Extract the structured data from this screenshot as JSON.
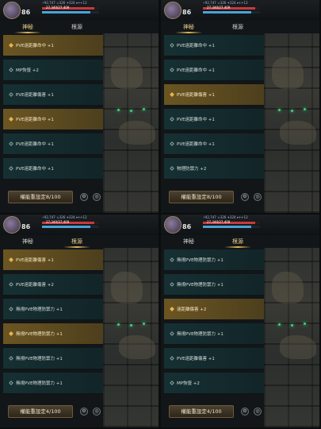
{
  "header": {
    "level": "86",
    "stats_line": "⚡92,747  ⚔326  ✦324  ▾++12",
    "hp_text": "27,340/27,409",
    "mp_text": "",
    "hp_fill": 0.92,
    "mp_fill": 0.85
  },
  "tabs": [
    "神秘",
    "根源"
  ],
  "panels": [
    {
      "active_tab": 0,
      "rows": [
        {
          "label": "PVE遠距離命中 +1",
          "highlight": true
        },
        {
          "label": "MP恢復 +2",
          "highlight": false
        },
        {
          "label": "PVE遠距離傷害 +1",
          "highlight": false
        },
        {
          "label": "PVE遠距離命中 +1",
          "highlight": true
        },
        {
          "label": "PVE遠距離命中 +1",
          "highlight": false
        },
        {
          "label": "PVE遠距離命中 +1",
          "highlight": false
        }
      ],
      "reset": "權能重設定8/100"
    },
    {
      "active_tab": 0,
      "rows": [
        {
          "label": "PVE遠距離命中 +1",
          "highlight": false
        },
        {
          "label": "PVE遠距離命中 +1",
          "highlight": false
        },
        {
          "label": "PVE遠距離傷害 +1",
          "highlight": true
        },
        {
          "label": "PVE遠距離命中 +1",
          "highlight": false
        },
        {
          "label": "PVE遠距離命中 +1",
          "highlight": false
        },
        {
          "label": "物理防禦力 +2",
          "highlight": false
        }
      ],
      "reset": "權能重設定8/100"
    },
    {
      "active_tab": 1,
      "rows": [
        {
          "label": "PVE遠距離傷害 +1",
          "highlight": true
        },
        {
          "label": "PVE遠距離傷害 +2",
          "highlight": false
        },
        {
          "label": "無視PVE物理防禦力 +1",
          "highlight": false
        },
        {
          "label": "無視PVE物理防禦力 +1",
          "highlight": true
        },
        {
          "label": "無視PVE物理防禦力 +1",
          "highlight": false
        },
        {
          "label": "無視PVE物理防禦力 +1",
          "highlight": false
        }
      ],
      "reset": "權能重設定4/100"
    },
    {
      "active_tab": 1,
      "rows": [
        {
          "label": "無視PVE物理防禦力 +1",
          "highlight": false
        },
        {
          "label": "無視PVE物理防禦力 +1",
          "highlight": false
        },
        {
          "label": "遠距離傷害 +2",
          "highlight": true
        },
        {
          "label": "無視PVE物理防禦力 +1",
          "highlight": false
        },
        {
          "label": "PVE遠距離傷害 +1",
          "highlight": false
        },
        {
          "label": "MP恢復 +2",
          "highlight": false
        }
      ],
      "reset": "權能重設定4/100"
    }
  ],
  "icons": {
    "settings": "gear-icon",
    "info": "circle-icon"
  }
}
